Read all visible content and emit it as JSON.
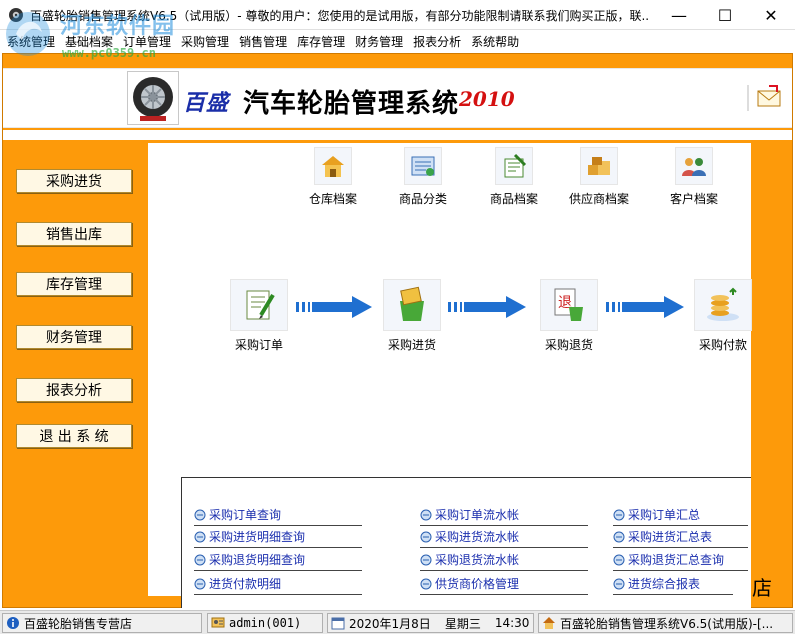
{
  "window": {
    "title": "百盛轮胎销售管理系统V6.5（试用版）- 尊敬的用户：您使用的是试用版，有部分功能限制请联系我们购买正版，联...",
    "controls": {
      "minimize": "—",
      "maximize": "☐",
      "close": "✕"
    }
  },
  "menu": [
    "系统管理",
    "基础档案",
    "订单管理",
    "采购管理",
    "销售管理",
    "库存管理",
    "财务管理",
    "报表分析",
    "系统帮助"
  ],
  "watermark": {
    "text1": "河东软件园",
    "text2": "www.pc0359.cn"
  },
  "banner": {
    "brand": "百盛",
    "system_name": "汽车轮胎管理系统",
    "year": "2010"
  },
  "sidebar": [
    {
      "label": "采购进货"
    },
    {
      "label": "销售出库"
    },
    {
      "label": "库存管理"
    },
    {
      "label": "财务管理"
    },
    {
      "label": "报表分析"
    },
    {
      "label": "退 出 系 统"
    }
  ],
  "archives": [
    {
      "label": "仓库档案",
      "icon": "warehouse-icon"
    },
    {
      "label": "商品分类",
      "icon": "category-icon"
    },
    {
      "label": "商品档案",
      "icon": "product-icon"
    },
    {
      "label": "供应商档案",
      "icon": "supplier-icon"
    },
    {
      "label": "客户档案",
      "icon": "customer-icon"
    }
  ],
  "flow": [
    {
      "label": "采购订单",
      "icon": "purchase-order-icon"
    },
    {
      "label": "采购进货",
      "icon": "purchase-receipt-icon"
    },
    {
      "label": "采购退货",
      "icon": "purchase-return-icon"
    },
    {
      "label": "采购付款",
      "icon": "purchase-payment-icon"
    }
  ],
  "reports": {
    "col1": [
      "采购订单查询",
      "采购进货明细查询",
      "采购退货明细查询",
      "进货付款明细"
    ],
    "col2": [
      "采购订单流水帐",
      "采购进货流水帐",
      "采购退货流水帐",
      "供货商价格管理"
    ],
    "col3": [
      "采购订单汇总",
      "采购进货汇总表",
      "采购退货汇总查询",
      "进货综合报表"
    ]
  },
  "overflow_char": "店",
  "statusbar": {
    "shop": "百盛轮胎销售专营店",
    "user": "admin(001)",
    "date": "2020年1月8日",
    "weekday": "星期三",
    "time": "14:30",
    "app": "百盛轮胎销售管理系统V6.5(试用版)-[..."
  },
  "colors": {
    "frame_orange": "#fd9a0a",
    "link_blue": "#1b2fae",
    "arrow_blue": "#1f6fd0"
  }
}
